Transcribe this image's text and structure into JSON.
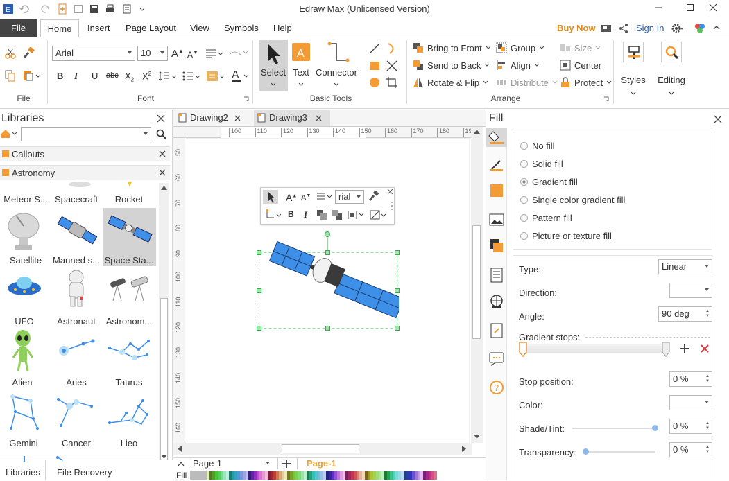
{
  "window": {
    "title": "Edraw Max (Unlicensed Version)"
  },
  "menubar": {
    "file": "File",
    "items": [
      "Home",
      "Insert",
      "Page Layout",
      "View",
      "Symbols",
      "Help"
    ],
    "buy_now": "Buy Now",
    "sign_in": "Sign In"
  },
  "ribbon": {
    "groups": {
      "file": "File",
      "font": "Font",
      "basic_tools": "Basic Tools",
      "arrange": "Arrange"
    },
    "font_name": "Arial",
    "font_size": "10",
    "tools": {
      "select": "Select",
      "text": "Text",
      "connector": "Connector"
    },
    "arrange": {
      "bring_to_front": "Bring to Front",
      "send_to_back": "Send to Back",
      "rotate_flip": "Rotate & Flip",
      "group": "Group",
      "align": "Align",
      "distribute": "Distribute",
      "size": "Size",
      "center": "Center",
      "protect": "Protect"
    },
    "styles": "Styles",
    "editing": "Editing"
  },
  "libraries": {
    "title": "Libraries",
    "search_value": "",
    "categories": [
      "Callouts",
      "Astronomy"
    ],
    "shapes": [
      [
        "Meteor S...",
        "Spacecraft",
        "Rocket"
      ],
      [
        "Satellite",
        "Manned s...",
        "Space Sta..."
      ],
      [
        "UFO",
        "Astronaut",
        "Astronom..."
      ],
      [
        "Alien",
        "Aries",
        "Taurus"
      ],
      [
        "Gemini",
        "Cancer",
        "Lieo"
      ]
    ],
    "bottom_tabs": [
      "Libraries",
      "File Recovery"
    ]
  },
  "documents": {
    "tabs": [
      "Drawing2",
      "Drawing3"
    ]
  },
  "ruler": {
    "h": [
      "100",
      "110",
      "120",
      "130",
      "140",
      "150",
      "160",
      "170",
      "180",
      "190",
      "20"
    ],
    "v": [
      "50",
      "60",
      "70",
      "80",
      "90",
      "100",
      "110",
      "120",
      "130",
      "140",
      "150",
      "160"
    ]
  },
  "mini_toolbar": {
    "font": "rial"
  },
  "pages": {
    "current": "Page-1",
    "tab": "Page-1",
    "fill_label": "Fill"
  },
  "fill_panel": {
    "title": "Fill",
    "options": [
      "No fill",
      "Solid fill",
      "Gradient fill",
      "Single color gradient fill",
      "Pattern fill",
      "Picture or texture fill"
    ],
    "selected": "Gradient fill",
    "type_label": "Type:",
    "type_value": "Linear",
    "direction_label": "Direction:",
    "angle_label": "Angle:",
    "angle_value": "90 deg",
    "gradient_stops_label": "Gradient stops:",
    "stop_position_label": "Stop position:",
    "stop_position_value": "0 %",
    "color_label": "Color:",
    "shade_label": "Shade/Tint:",
    "shade_value": "0 %",
    "transparency_label": "Transparency:",
    "transparency_value": "0 %"
  },
  "colors": {
    "accent_orange": "#e8a33a",
    "satellite_blue": "#3d8fe8",
    "selection_green": "#2fae4a"
  }
}
